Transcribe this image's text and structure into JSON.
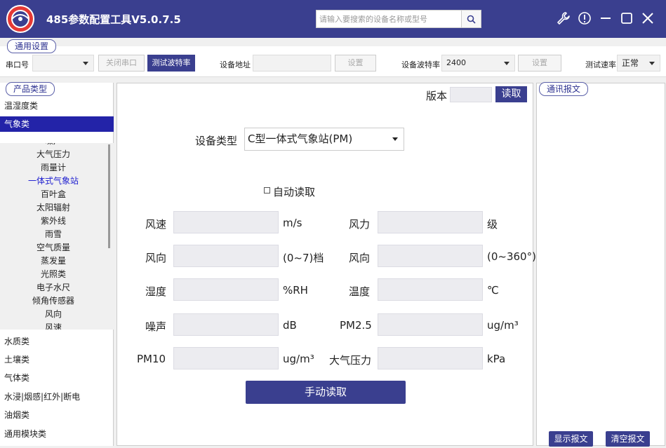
{
  "app": {
    "title": "485参数配置工具V5.0.7.5",
    "search_placeholder": "请输入要搜索的设备名称或型号",
    "icons": [
      "wrench-icon",
      "info-icon",
      "minimize-icon",
      "maximize-icon",
      "close-icon"
    ]
  },
  "general": {
    "legend": "通用设置",
    "port_label": "串口号",
    "port_value": "",
    "close_port_btn": "关闭串口",
    "test_baud_btn": "测试波特率",
    "addr_label": "设备地址",
    "addr_value": "",
    "set_btn_1": "设置",
    "baud_label": "设备波特率",
    "baud_value": "2400",
    "set_btn_2": "设置",
    "speed_label": "测试速率",
    "speed_value": "正常"
  },
  "product": {
    "legend": "产品类型",
    "categories_top": [
      "温湿度类",
      "气象类"
    ],
    "sub_items": [
      "噪声",
      "大气压力",
      "雨量计",
      "一体式气象站",
      "百叶盒",
      "太阳辐射",
      "紫外线",
      "雨雪",
      "空气质量",
      "蒸发量",
      "光照类",
      "电子水尺",
      "倾角传感器",
      "风向",
      "风速"
    ],
    "active_sub": "一体式气象站",
    "categories_bottom": [
      "水质类",
      "土壤类",
      "气体类",
      "水浸|烟感|红外|断电",
      "油烟类",
      "通用模块类"
    ]
  },
  "center": {
    "version_label": "版本",
    "version_value": "",
    "read_btn": "读取",
    "device_type_label": "设备类型",
    "device_type_value": "C型一体式气象站(PM)",
    "auto_read_label": "自动读取",
    "rows": [
      {
        "l1": "风速",
        "u1": "m/s",
        "l2": "风力",
        "u2": "级"
      },
      {
        "l1": "风向",
        "u1": "(0~7)档",
        "l2": "风向",
        "u2": "(0~360°)"
      },
      {
        "l1": "湿度",
        "u1": "%RH",
        "l2": "温度",
        "u2": "℃"
      },
      {
        "l1": "噪声",
        "u1": "dB",
        "l2": "PM2.5",
        "u2": "ug/m³"
      },
      {
        "l1": "PM10",
        "u1": "ug/m³",
        "l2": "大气压力",
        "u2": "kPa"
      }
    ],
    "manual_read_btn": "手动读取"
  },
  "comm": {
    "legend": "通讯报文",
    "show_btn": "显示报文",
    "clear_btn": "清空报文"
  },
  "colors": {
    "primary": "#3a3f8f",
    "selected": "#2323a8",
    "active_link": "#2323d0"
  }
}
